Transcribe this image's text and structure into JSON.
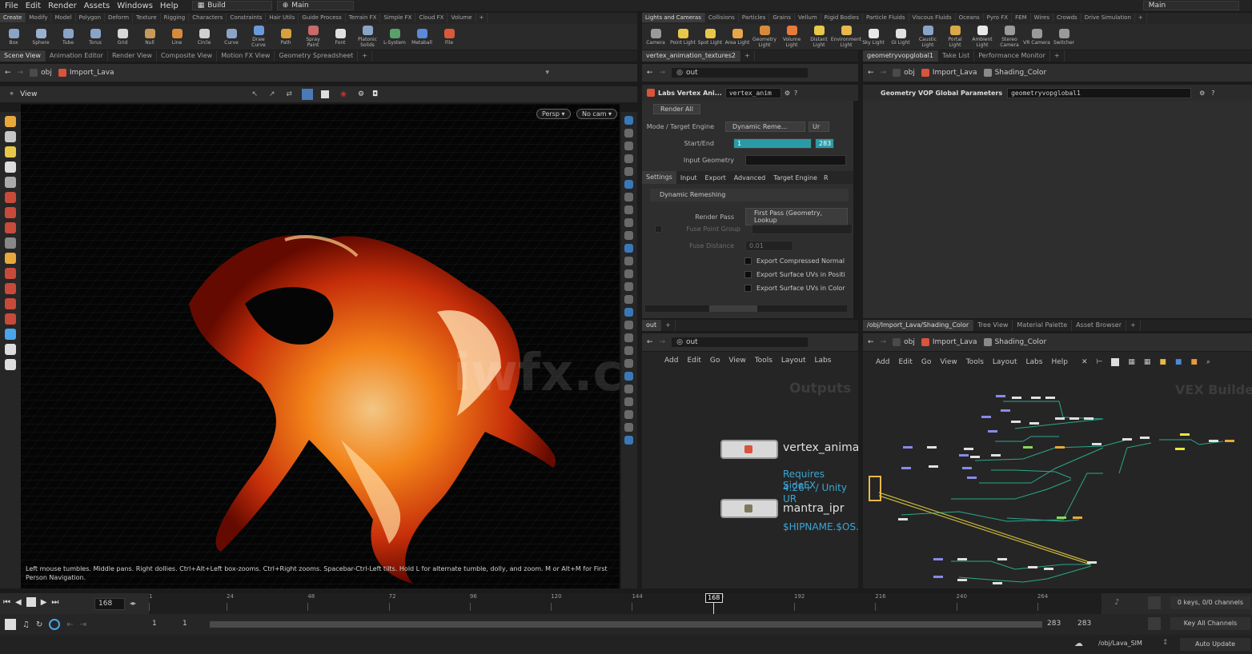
{
  "menubar": {
    "items": [
      "File",
      "Edit",
      "Render",
      "Assets",
      "Windows",
      "Help"
    ],
    "desktop": "Build",
    "context_left": "Main",
    "context_right": "Main"
  },
  "left_shelf": {
    "tabs": [
      "Create",
      "Modify",
      "Model",
      "Polygon",
      "Deform",
      "Texture",
      "Rigging",
      "Characters",
      "Constraints",
      "Hair Utils",
      "Guide Process",
      "Terrain FX",
      "Simple FX",
      "Cloud FX",
      "Volume"
    ],
    "tools": [
      {
        "label": "Box",
        "color": "#8aa4c8"
      },
      {
        "label": "Sphere",
        "color": "#9ab0d0"
      },
      {
        "label": "Tube",
        "color": "#8aa4c8"
      },
      {
        "label": "Torus",
        "color": "#8aa4c8"
      },
      {
        "label": "Grid",
        "color": "#d8d8d8"
      },
      {
        "label": "Null",
        "color": "#c89a5a"
      },
      {
        "label": "Line",
        "color": "#d88a3a"
      },
      {
        "label": "Circle",
        "color": "#cfcfcf"
      },
      {
        "label": "Curve",
        "color": "#8aa4c8"
      },
      {
        "label": "Draw Curve",
        "color": "#6a9ad8"
      },
      {
        "label": "Path",
        "color": "#d8a03a"
      },
      {
        "label": "Spray Paint",
        "color": "#c86a6a"
      },
      {
        "label": "Font",
        "color": "#e0e0e0"
      },
      {
        "label": "Platonic Solids",
        "color": "#8aa4c8"
      },
      {
        "label": "L-System",
        "color": "#5aa06a"
      },
      {
        "label": "Metaball",
        "color": "#5a8ad8"
      },
      {
        "label": "File",
        "color": "#d85a3a"
      }
    ]
  },
  "right_shelf": {
    "tabs": [
      "Lights and Cameras",
      "Collisions",
      "Particles",
      "Grains",
      "Vellum",
      "Rigid Bodies",
      "Particle Fluids",
      "Viscous Fluids",
      "Oceans",
      "Pyro FX",
      "FEM",
      "Wires",
      "Crowds",
      "Drive Simulation"
    ],
    "tools": [
      {
        "label": "Camera",
        "color": "#9a9a9a"
      },
      {
        "label": "Point Light",
        "color": "#e8c84a"
      },
      {
        "label": "Spot Light",
        "color": "#e8c84a"
      },
      {
        "label": "Area Light",
        "color": "#e8a84a"
      },
      {
        "label": "Geometry Light",
        "color": "#d88a3a"
      },
      {
        "label": "Volume Light",
        "color": "#e87a3a"
      },
      {
        "label": "Distant Light",
        "color": "#e8c84a"
      },
      {
        "label": "Environment Light",
        "color": "#e8b84a"
      },
      {
        "label": "Sky Light",
        "color": "#e8e8e8"
      },
      {
        "label": "GI Light",
        "color": "#e0e0e0"
      },
      {
        "label": "Caustic Light",
        "color": "#8aa4c8"
      },
      {
        "label": "Portal Light",
        "color": "#d8a84a"
      },
      {
        "label": "Ambient Light",
        "color": "#e8e8e8"
      },
      {
        "label": "Stereo Camera",
        "color": "#9a9a9a"
      },
      {
        "label": "VR Camera",
        "color": "#9a9a9a"
      },
      {
        "label": "Switcher",
        "color": "#9a9a9a"
      }
    ]
  },
  "scene_view": {
    "tabs": [
      "Scene View",
      "Animation Editor",
      "Render View",
      "Composite View",
      "Motion FX View",
      "Geometry Spreadsheet"
    ],
    "path": [
      "obj",
      "Import_Lava"
    ],
    "title": "View",
    "persp": "Persp",
    "cam": "No cam",
    "hint": "Left mouse tumbles. Middle pans. Right dollies. Ctrl+Alt+Left box-zooms. Ctrl+Right zooms. Spacebar-Ctrl-Left tilts. Hold L for alternate tumble, dolly, and zoom.    M or Alt+M for First Person Navigation.",
    "watermark": "iwfx.com"
  },
  "params": {
    "tab": "vertex_animation_textures2",
    "path": "out",
    "node_type": "Labs Vertex Ani...",
    "node_name": "vertex_anim",
    "render_all": "Render All",
    "mode_label": "Mode / Target Engine",
    "mode_value": "Dynamic Reme...",
    "mode_extra": "Ur",
    "startend_label": "Start/End",
    "start": "1",
    "end": "283",
    "input_geo_label": "Input Geometry",
    "tabs": [
      "Settings",
      "Input",
      "Export",
      "Advanced",
      "Target Engine",
      "R"
    ],
    "section": "Dynamic Remeshing",
    "render_pass_label": "Render Pass",
    "render_pass_value": "First Pass (Geometry, Lookup",
    "fuse_group_label": "Fuse Point Group",
    "fuse_dist_label": "Fuse Distance",
    "fuse_dist_value": "0.01",
    "checks": [
      "Export Compressed Normal",
      "Export Surface UVs in Positi",
      "Export Surface UVs in Color"
    ]
  },
  "vop_params": {
    "tabs": [
      "geometryvopglobal1",
      "Take List",
      "Performance Monitor"
    ],
    "path": [
      "obj",
      "Import_Lava",
      "Shading_Color"
    ],
    "title": "Geometry VOP Global Parameters",
    "name": "geometryvopglobal1"
  },
  "out_network": {
    "tab": "out",
    "path": "out",
    "menu": [
      "Add",
      "Edit",
      "Go",
      "View",
      "Tools",
      "Layout",
      "Labs"
    ],
    "label": "Outputs",
    "nodes": [
      {
        "name": "vertex_animat",
        "sub1": "Requires SideFX",
        "sub2": "4.26+ / Unity UR"
      },
      {
        "name": "mantra_ipr",
        "sub1": "$HIPNAME.$OS.",
        "sub2": ""
      }
    ]
  },
  "vex_network": {
    "tabs": [
      "/obj/Import_Lava/Shading_Color",
      "Tree View",
      "Material Palette",
      "Asset Browser"
    ],
    "path": [
      "obj",
      "Import_Lava",
      "Shading_Color"
    ],
    "menu": [
      "Add",
      "Edit",
      "Go",
      "View",
      "Tools",
      "Layout",
      "Labs",
      "Help"
    ],
    "label": "VEX Builder"
  },
  "timeline": {
    "frame": "168",
    "ticks": [
      "1",
      "24",
      "48",
      "72",
      "96",
      "120",
      "144",
      "168",
      "192",
      "216",
      "240",
      "264"
    ],
    "current": "168",
    "keys": "0 keys, 0/0 channels",
    "key_all": "Key All Channels"
  },
  "range": {
    "start": "1",
    "start2": "1",
    "end": "283",
    "end2": "283"
  },
  "status": {
    "path": "/obj/Lava_SIM",
    "update": "Auto Update"
  }
}
